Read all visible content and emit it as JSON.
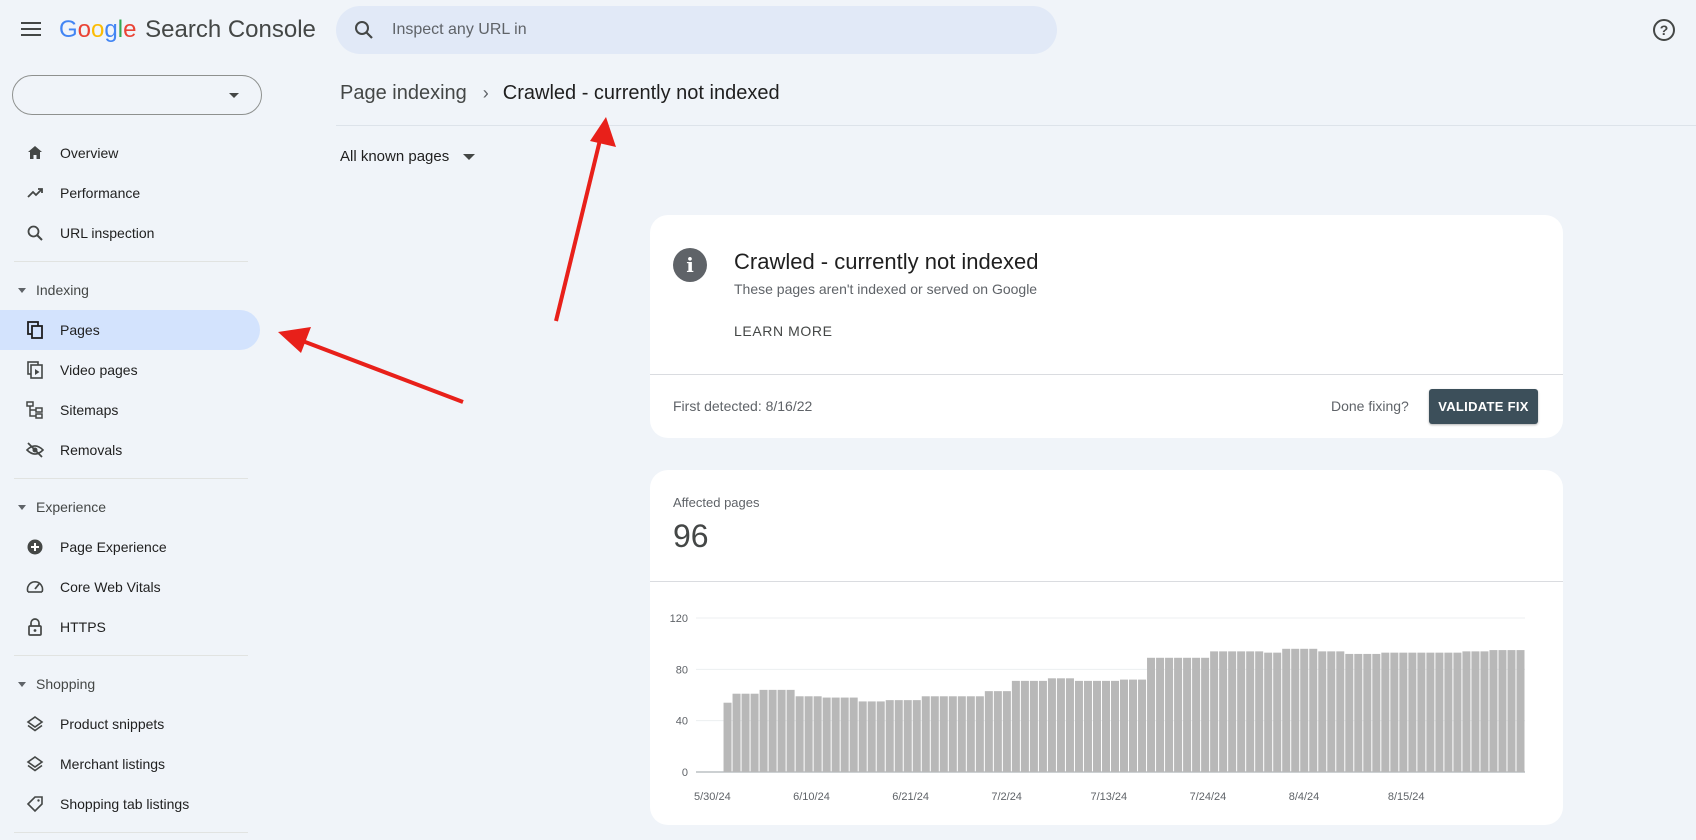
{
  "app": {
    "logo_letters": [
      {
        "ch": "G",
        "color": "#4285f4"
      },
      {
        "ch": "o",
        "color": "#ea4335"
      },
      {
        "ch": "o",
        "color": "#fbbc04"
      },
      {
        "ch": "g",
        "color": "#4285f4"
      },
      {
        "ch": "l",
        "color": "#34a853"
      },
      {
        "ch": "e",
        "color": "#ea4335"
      }
    ],
    "product_name": "Search Console"
  },
  "search": {
    "placeholder": "Inspect any URL in",
    "value": ""
  },
  "property_selector": {
    "value": ""
  },
  "sidebar": {
    "items": {
      "overview": "Overview",
      "performance": "Performance",
      "url_inspection": "URL inspection",
      "pages": "Pages",
      "video_pages": "Video pages",
      "sitemaps": "Sitemaps",
      "removals": "Removals",
      "page_experience": "Page Experience",
      "core_web_vitals": "Core Web Vitals",
      "https": "HTTPS",
      "product_snippets": "Product snippets",
      "merchant_listings": "Merchant listings",
      "shopping_tab_listings": "Shopping tab listings"
    },
    "sections": {
      "indexing": "Indexing",
      "experience": "Experience",
      "shopping": "Shopping"
    },
    "active_item": "pages"
  },
  "breadcrumb": {
    "parent": "Page indexing",
    "separator": "›",
    "current": "Crawled - currently not indexed"
  },
  "filter": {
    "label": "All known pages"
  },
  "issue": {
    "title": "Crawled - currently not indexed",
    "subtitle": "These pages aren't indexed or served on Google",
    "learn_more": "LEARN MORE",
    "first_detected": "First detected: 8/16/22",
    "done_fixing": "Done fixing?",
    "validate_button": "VALIDATE FIX"
  },
  "affected": {
    "label": "Affected pages",
    "count": "96"
  },
  "colors": {
    "accent_active": "#d3e3fd",
    "validate_button": "#3c4f5a",
    "bars": "#b8b8b8",
    "annotation_arrows": "#e8201a"
  },
  "chart_data": {
    "type": "bar",
    "ylim": [
      0,
      120
    ],
    "yticks": [
      0,
      40,
      80,
      120
    ],
    "x_tick_labels": [
      "5/30/24",
      "6/10/24",
      "6/21/24",
      "7/2/24",
      "7/13/24",
      "7/24/24",
      "8/4/24",
      "8/15/24"
    ],
    "x_tick_indices": [
      0,
      11,
      22,
      33,
      44,
      55,
      66,
      77
    ],
    "categories_start": "5/30/24",
    "values": [
      0,
      0,
      0,
      54,
      61,
      61,
      61,
      64,
      64,
      64,
      64,
      59,
      59,
      59,
      58,
      58,
      58,
      58,
      55,
      55,
      55,
      56,
      56,
      56,
      56,
      59,
      59,
      59,
      59,
      59,
      59,
      59,
      63,
      63,
      63,
      71,
      71,
      71,
      71,
      73,
      73,
      73,
      71,
      71,
      71,
      71,
      71,
      72,
      72,
      72,
      89,
      89,
      89,
      89,
      89,
      89,
      89,
      94,
      94,
      94,
      94,
      94,
      94,
      93,
      93,
      96,
      96,
      96,
      96,
      94,
      94,
      94,
      92,
      92,
      92,
      92,
      93,
      93,
      93,
      93,
      93,
      93,
      93,
      93,
      93,
      94,
      94,
      94,
      95,
      95,
      95,
      95
    ],
    "grid": true,
    "legend": "none"
  }
}
